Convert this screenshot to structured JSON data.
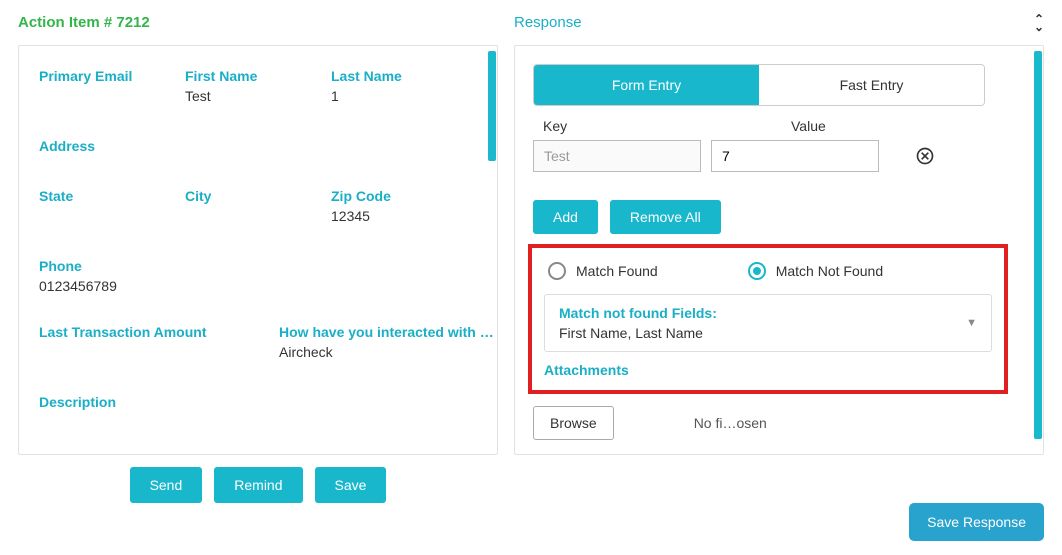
{
  "left": {
    "title": "Action Item # 7212",
    "fields": {
      "primary_email": {
        "label": "Primary Email",
        "value": ""
      },
      "first_name": {
        "label": "First Name",
        "value": "Test"
      },
      "last_name": {
        "label": "Last Name",
        "value": "1"
      },
      "address": {
        "label": "Address",
        "value": ""
      },
      "state": {
        "label": "State",
        "value": ""
      },
      "city": {
        "label": "City",
        "value": ""
      },
      "zip": {
        "label": "Zip Code",
        "value": "12345"
      },
      "phone": {
        "label": "Phone",
        "value": "0123456789"
      },
      "last_txn": {
        "label": "Last Transaction Amount",
        "value": ""
      },
      "interacted": {
        "label": "How have you interacted with …",
        "value": "Aircheck"
      },
      "description": {
        "label": "Description",
        "value": ""
      }
    },
    "buttons": {
      "send": "Send",
      "remind": "Remind",
      "save": "Save"
    }
  },
  "right": {
    "title": "Response",
    "tabs": {
      "form": "Form Entry",
      "fast": "Fast Entry"
    },
    "kv": {
      "key_label": "Key",
      "val_label": "Value",
      "key_value": "Test",
      "val_value": "7"
    },
    "buttons": {
      "add": "Add",
      "remove_all": "Remove All"
    },
    "radios": {
      "found": "Match Found",
      "not_found": "Match Not Found"
    },
    "match_box": {
      "title": "Match not found Fields:",
      "value": "First Name, Last Name"
    },
    "attachments_label": "Attachments",
    "browse": "Browse",
    "no_file": "No fi…osen",
    "save_response": "Save Response"
  }
}
